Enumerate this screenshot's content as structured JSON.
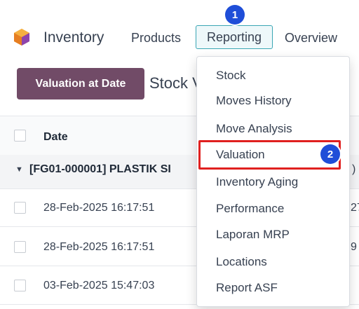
{
  "colors": {
    "brand": "#714b67",
    "accent": "#3aa6b4",
    "badge": "#1f4ed8",
    "highlight": "#e0201f"
  },
  "nav": {
    "app_icon": "odoo-inventory-logo-icon",
    "app_name": "Inventory",
    "products": "Products",
    "reporting": "Reporting",
    "overview": "Overview"
  },
  "control_panel": {
    "valuation_button": "Valuation at Date",
    "breadcrumb": "Stock V"
  },
  "list": {
    "header_date": "Date",
    "group_label": "[FG01-000001] PLASTIK SI",
    "group_edge": ")",
    "rows": [
      {
        "date": "28-Feb-2025 16:17:51",
        "edge": "27"
      },
      {
        "date": "28-Feb-2025 16:17:51",
        "edge": "9"
      },
      {
        "date": "03-Feb-2025 15:47:03",
        "edge": ""
      }
    ]
  },
  "reporting_menu": {
    "items": [
      "Stock",
      "Moves History",
      "Move Analysis",
      "Valuation",
      "Inventory Aging",
      "Performance",
      "Laporan MRP",
      "Locations",
      "Report ASF"
    ]
  },
  "annotations": {
    "step1": "1",
    "step2": "2"
  }
}
